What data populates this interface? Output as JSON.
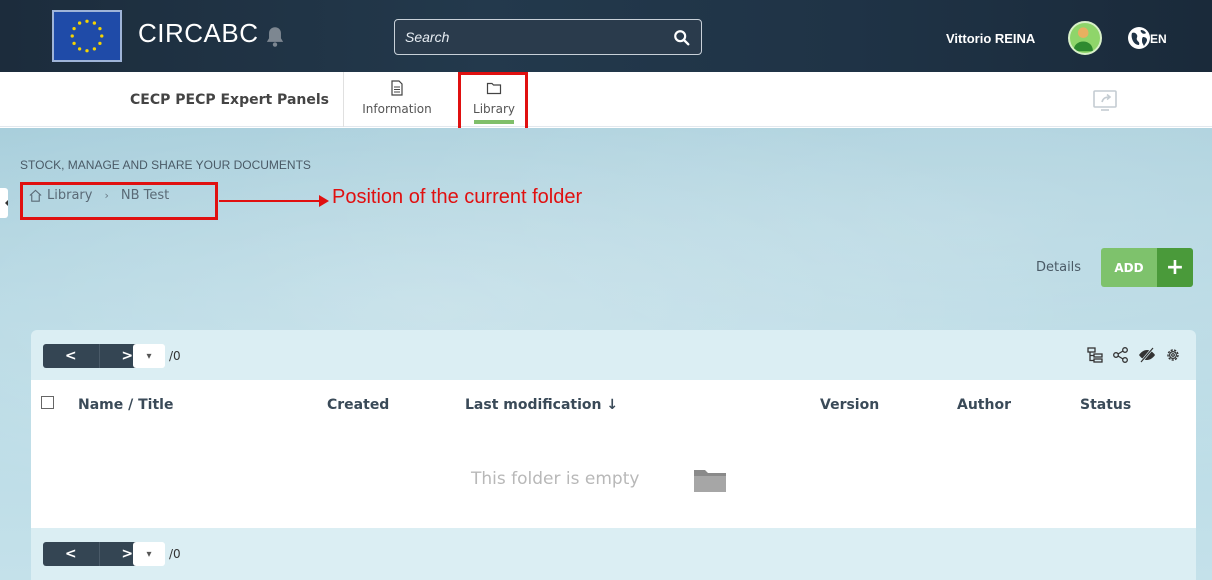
{
  "header": {
    "brand": "CIRCABC",
    "search_placeholder": "Search",
    "user_name": "Vittorio REINA",
    "language": "EN"
  },
  "nav": {
    "group_name": "CECP PECP Expert Panels",
    "tabs": [
      {
        "label": "Information",
        "icon": "document-icon"
      },
      {
        "label": "Library",
        "icon": "folder-icon",
        "active": true
      }
    ]
  },
  "main": {
    "section_title": "STOCK, MANAGE AND SHARE YOUR DOCUMENTS",
    "breadcrumb": [
      "Library",
      "NB Test"
    ],
    "annotation": "Position of the current folder",
    "details_label": "Details",
    "add_label": "ADD",
    "add_symbol": "+"
  },
  "table": {
    "page_total": "/0",
    "prev_symbol": "<",
    "next_symbol": ">",
    "columns": [
      "Name  /  Title",
      "Created",
      "Last modification ↓",
      "Version",
      "Author",
      "Status"
    ],
    "empty_message": "This folder is empty"
  },
  "colors": {
    "annotation": "#e01010",
    "add_button": "#7ec26c",
    "add_button_dark": "#4a9a3a",
    "topbar": "#1f3346"
  }
}
